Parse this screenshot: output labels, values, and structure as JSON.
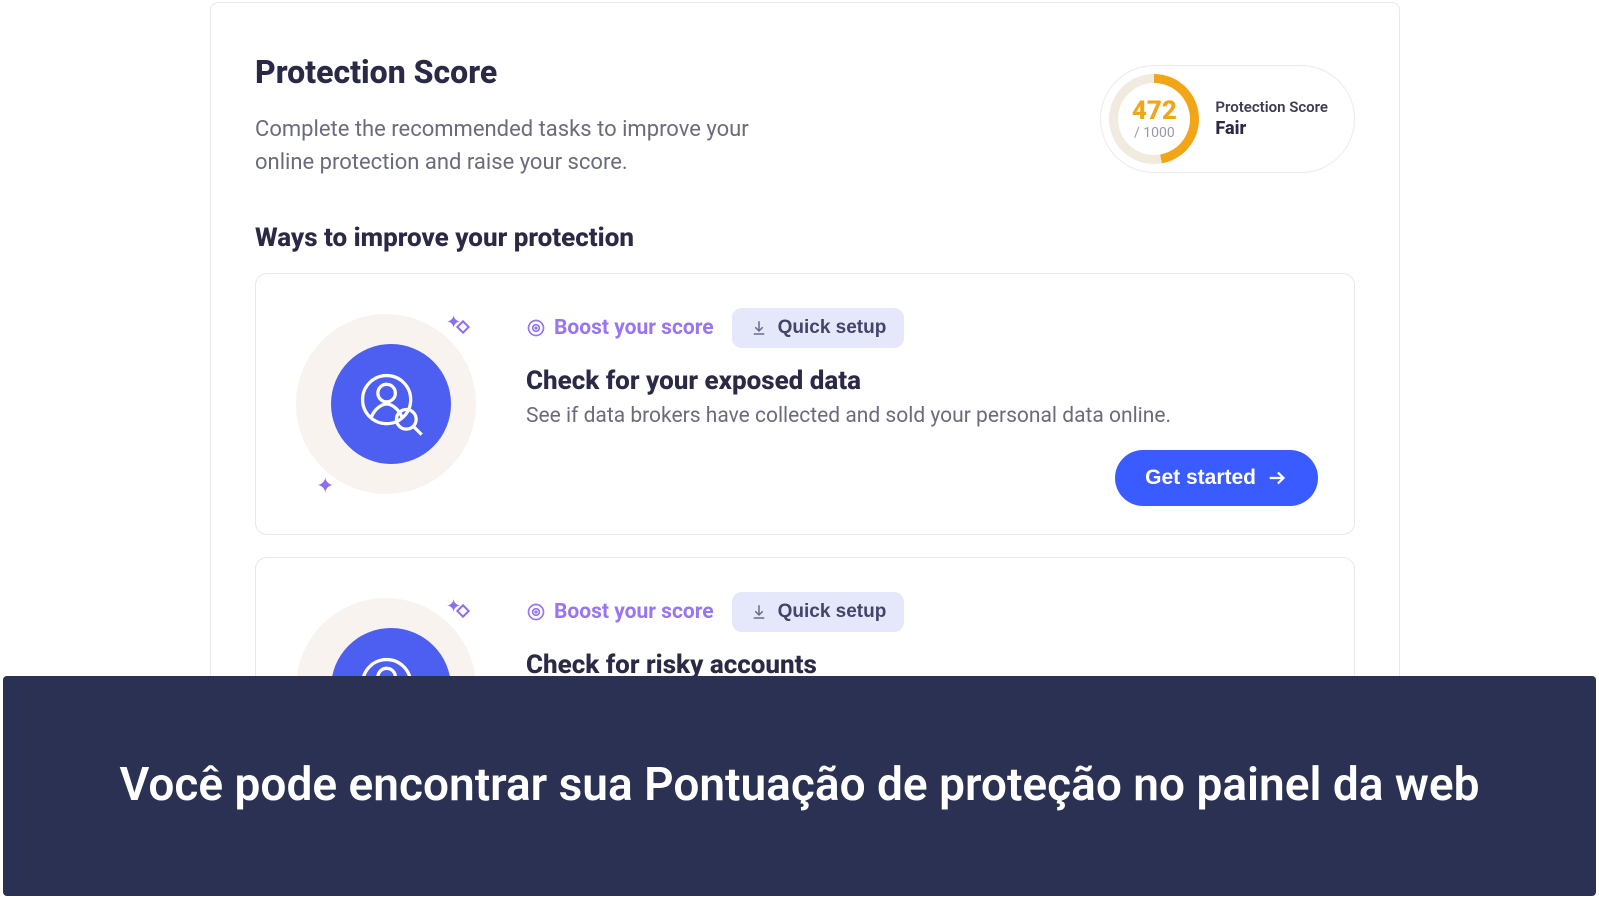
{
  "header": {
    "title": "Protection Score",
    "description": "Complete the recommended tasks to improve your online protection and raise your score."
  },
  "score": {
    "value": "472",
    "max_label": "/ 1000",
    "label": "Protection Score",
    "rating": "Fair"
  },
  "improve_section": {
    "heading": "Ways to improve your protection"
  },
  "cards": [
    {
      "boost_label": "Boost your score",
      "quick_setup_label": "Quick setup",
      "title": "Check for your exposed data",
      "description": "See if data brokers have collected and sold your personal data online.",
      "cta_label": "Get started"
    },
    {
      "boost_label": "Boost your score",
      "quick_setup_label": "Quick setup",
      "title": "Check for risky accounts",
      "description": ""
    }
  ],
  "caption": "Você pode encontrar sua Pontuação de proteção no painel da web"
}
